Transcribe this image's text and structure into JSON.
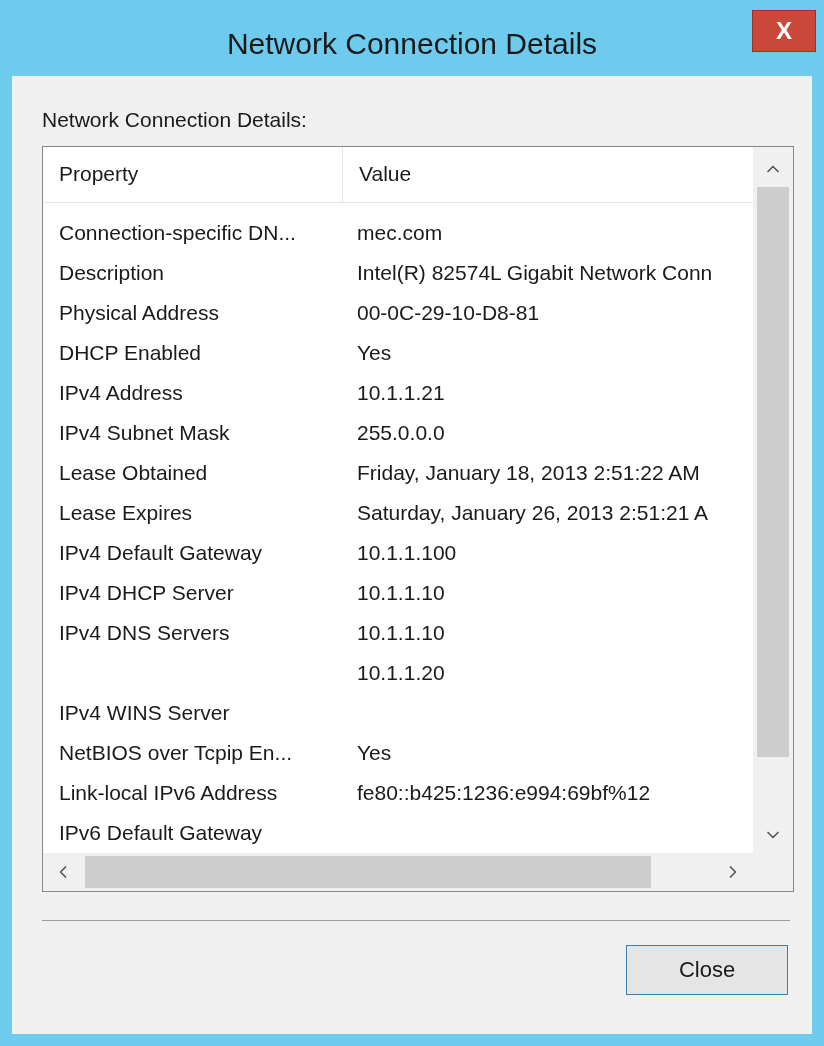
{
  "window": {
    "title": "Network Connection Details",
    "close_label": "X"
  },
  "group_label": "Network Connection Details:",
  "table": {
    "columns": [
      "Property",
      "Value"
    ],
    "rows": [
      {
        "property": "Connection-specific DN...",
        "value": "mec.com"
      },
      {
        "property": "Description",
        "value": "Intel(R) 82574L Gigabit Network Conn"
      },
      {
        "property": "Physical Address",
        "value": "00-0C-29-10-D8-81"
      },
      {
        "property": "DHCP Enabled",
        "value": "Yes"
      },
      {
        "property": "IPv4 Address",
        "value": "10.1.1.21"
      },
      {
        "property": "IPv4 Subnet Mask",
        "value": "255.0.0.0"
      },
      {
        "property": "Lease Obtained",
        "value": "Friday, January 18, 2013 2:51:22 AM"
      },
      {
        "property": "Lease Expires",
        "value": "Saturday, January 26, 2013 2:51:21 A"
      },
      {
        "property": "IPv4 Default Gateway",
        "value": "10.1.1.100"
      },
      {
        "property": "IPv4 DHCP Server",
        "value": "10.1.1.10"
      },
      {
        "property": "IPv4 DNS Servers",
        "value": "10.1.1.10"
      },
      {
        "value": "10.1.1.20"
      },
      {
        "property": "IPv4 WINS Server"
      },
      {
        "property": "NetBIOS over Tcpip En...",
        "value": "Yes"
      },
      {
        "property": "Link-local IPv6 Address",
        "value": "fe80::b425:1236:e994:69bf%12"
      },
      {
        "property": "IPv6 Default Gateway"
      }
    ]
  },
  "buttons": [
    "Close"
  ]
}
